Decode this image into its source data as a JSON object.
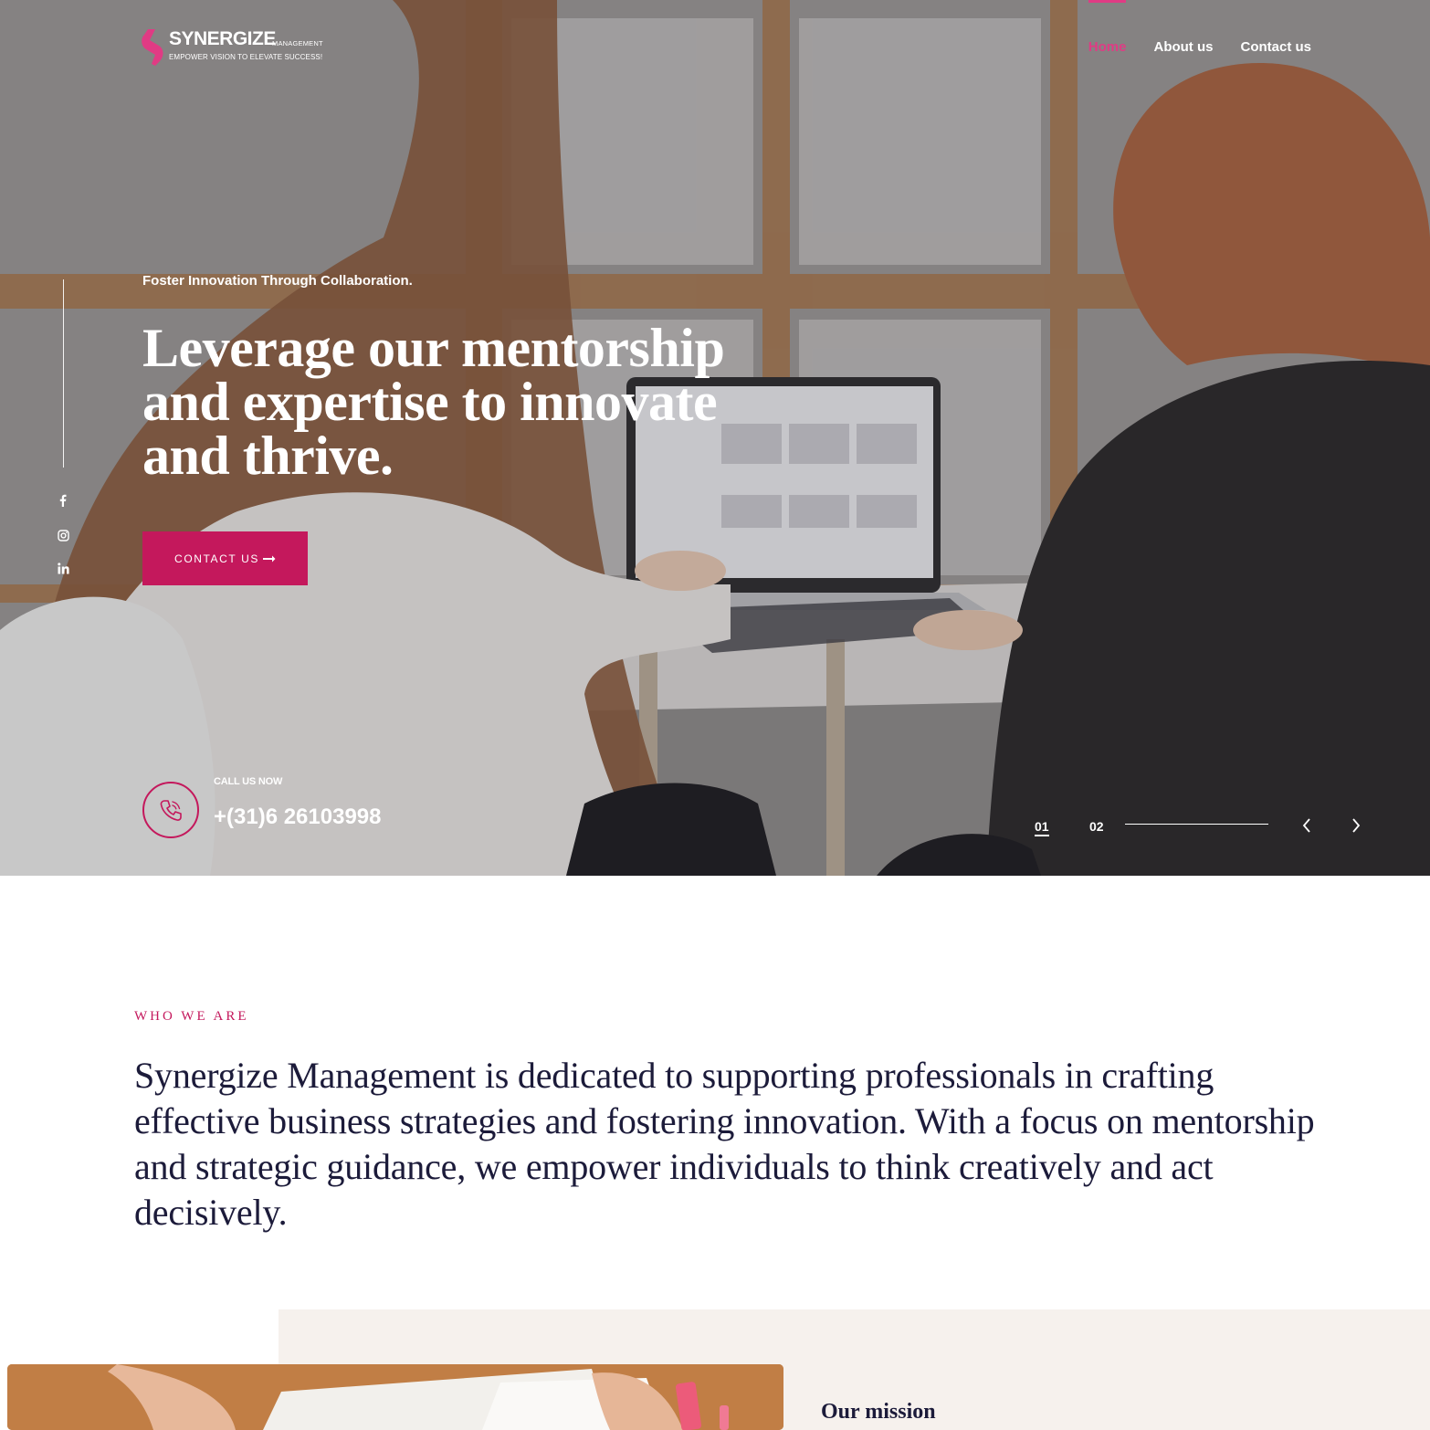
{
  "brand": {
    "name": "SYNERGIZE",
    "sub": "MANAGEMENT",
    "tagline": "EMPOWER VISION TO ELEVATE SUCCESS!",
    "accent_color": "#c4185c",
    "logo_mark_color": "#e03b84"
  },
  "nav": {
    "items": [
      {
        "label": "Home",
        "active": true
      },
      {
        "label": "About us",
        "active": false
      },
      {
        "label": "Contact us",
        "active": false
      }
    ]
  },
  "social": {
    "icons": [
      "facebook-icon",
      "instagram-icon",
      "linkedin-icon"
    ]
  },
  "hero": {
    "eyebrow": "Foster Innovation Through Collaboration.",
    "headline": "Leverage our mentorship and expertise to innovate and thrive.",
    "cta_label": "CONTACT US",
    "cta_icon": "arrow-right-icon",
    "call_label": "CALL US NOW",
    "phone": "+(31)6 26103998",
    "phone_icon": "phone-icon",
    "slides": [
      "01",
      "02"
    ],
    "current_slide": "01"
  },
  "who": {
    "label": "WHO WE ARE",
    "text": "Synergize Management is dedicated to supporting professionals in crafting effective business strategies and fostering innovation. With a focus on mentorship and strategic guidance, we empower individuals to think creatively and act decisively."
  },
  "mission": {
    "title": "Our mission"
  },
  "colors": {
    "heading_dark": "#1c1b3a",
    "mission_bg": "#f6f1ed",
    "nav_active": "#e03b84"
  }
}
